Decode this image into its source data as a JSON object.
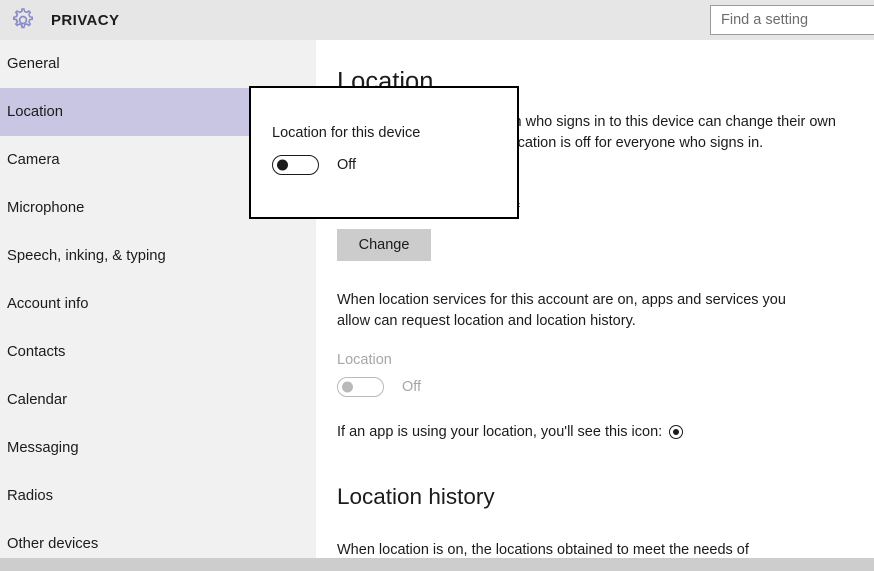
{
  "header": {
    "title": "PRIVACY",
    "gear_icon": "gear-icon",
    "accent_color": "#8c8ac8"
  },
  "search": {
    "placeholder": "Find a setting",
    "value": ""
  },
  "sidebar": {
    "selected": "Location",
    "background": "#f1f1f1",
    "selected_color": "#c8c6e2",
    "items": [
      {
        "label": "General"
      },
      {
        "label": "Location"
      },
      {
        "label": "Camera"
      },
      {
        "label": "Microphone"
      },
      {
        "label": "Speech, inking, & typing"
      },
      {
        "label": "Account info"
      },
      {
        "label": "Contacts"
      },
      {
        "label": "Calendar"
      },
      {
        "label": "Messaging"
      },
      {
        "label": "Radios"
      },
      {
        "label": "Other devices"
      }
    ]
  },
  "main": {
    "page_title": "Location",
    "intro_paragraph": "If location is on, each person who signs in to this device can change their own location settings. If it's off, location is off for everyone who signs in.",
    "device_status_line": "Location for this device is off",
    "change_button": "Change",
    "account_paragraph": "When location services for this account are on, apps and services you allow can request location and location history.",
    "location_toggle": {
      "label": "Location",
      "state": "Off",
      "disabled": true
    },
    "app_icon_line": "If an app is using your location, you'll see this icon:",
    "app_icon_name": "location-indicator-icon",
    "history_section_title": "Location history",
    "history_paragraph": "When location is on, the locations obtained to meet the needs of"
  },
  "dialog": {
    "title": "Location for this device",
    "toggle_state": "Off",
    "toggle_on": false
  }
}
